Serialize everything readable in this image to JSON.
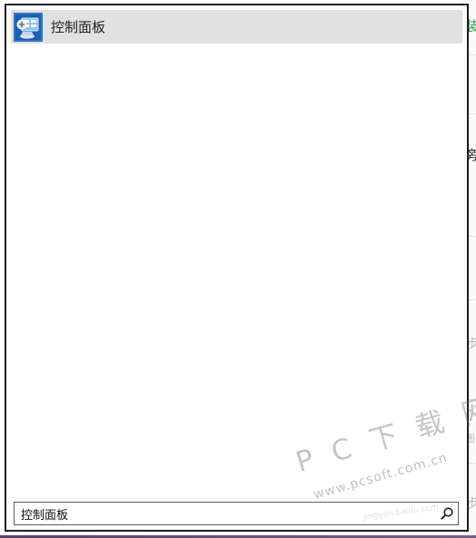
{
  "background_page": {
    "chars": [
      {
        "text": "装",
        "style": "green"
      },
      {
        "text": "旁",
        "style": "normal"
      },
      {
        "text": "步",
        "style": "faded"
      },
      {
        "text": "图",
        "style": "faded"
      },
      {
        "text": "步",
        "style": "faded"
      }
    ]
  },
  "search_results": [
    {
      "label": "控制面板",
      "icon": "control-panel-icon"
    }
  ],
  "search": {
    "value": "控制面板",
    "button_icon": "search-icon"
  },
  "watermark": {
    "main": "P C 下 载 网",
    "url": "www.pcsoft.com.cn",
    "faint": "jingyan.baidu.com"
  },
  "colors": {
    "result_highlight": "#e1e1e1",
    "popup_border": "#1c1c1c",
    "icon_blue": "#1b5fae"
  }
}
